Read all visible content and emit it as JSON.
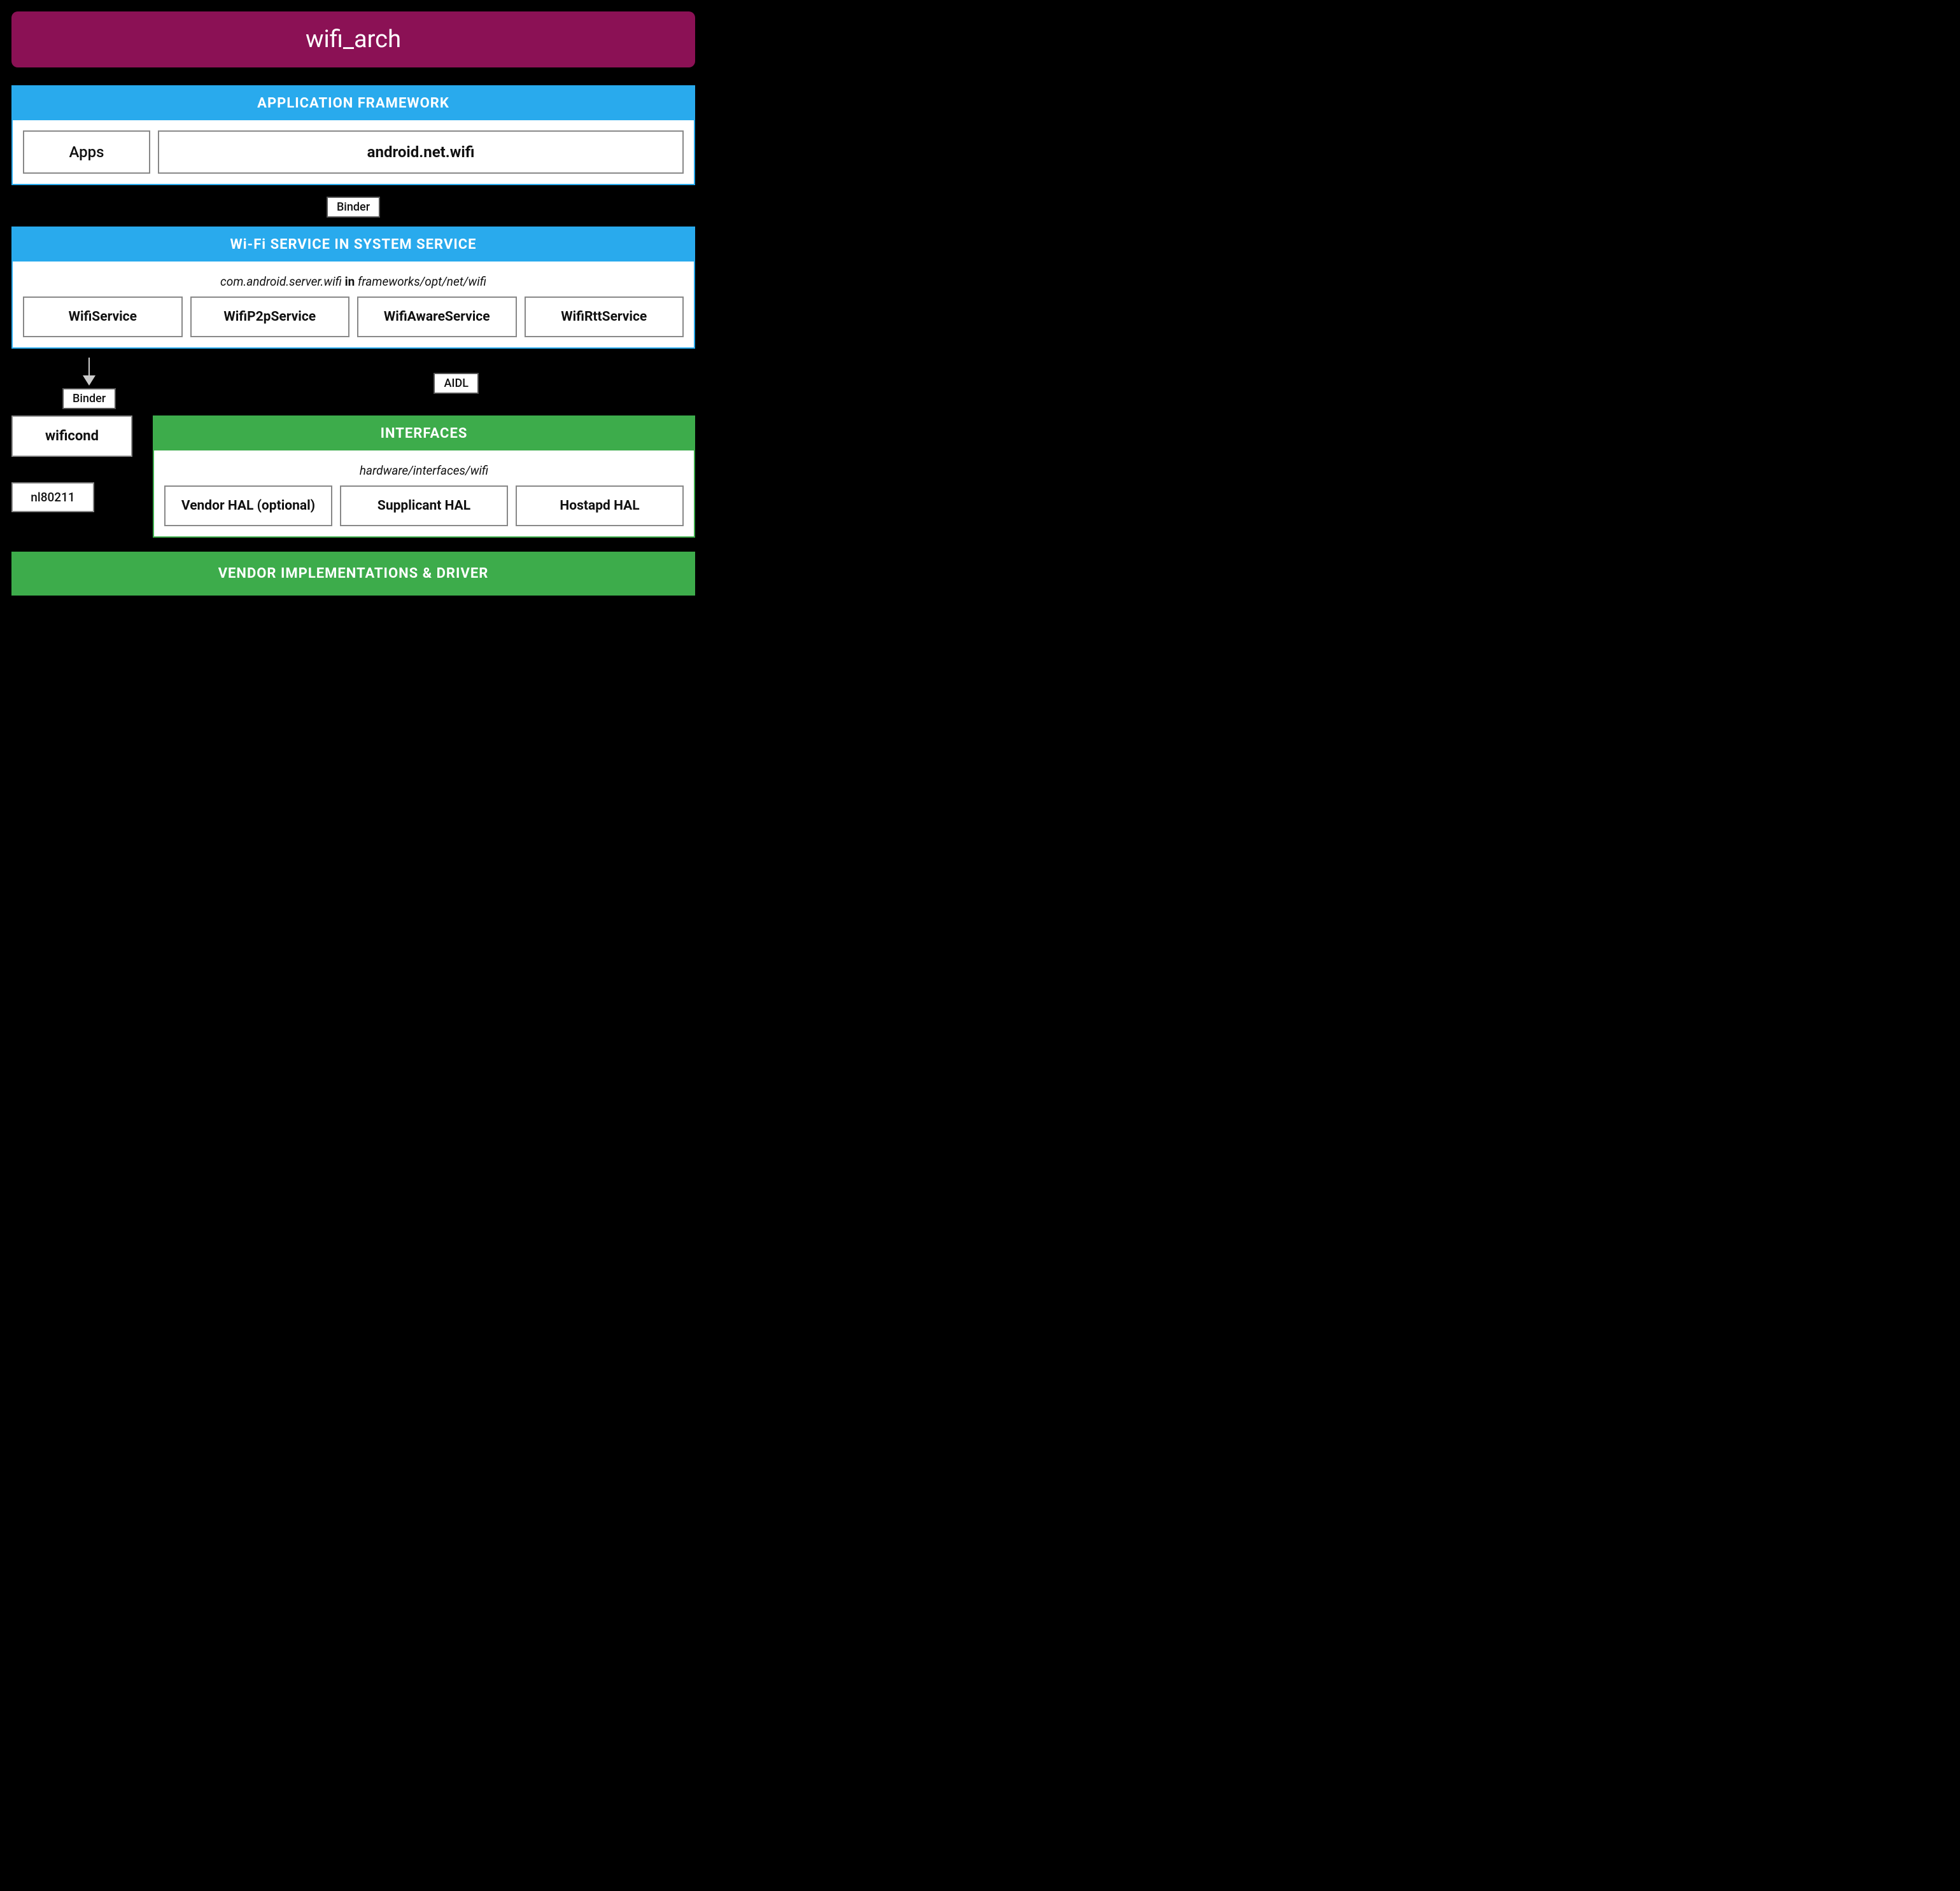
{
  "title": "wifi_arch",
  "app_framework": {
    "header": "APPLICATION FRAMEWORK",
    "apps_label": "Apps",
    "android_net_wifi_label": "android.net.wifi"
  },
  "binder_label": "Binder",
  "wifi_service": {
    "header": "Wi-Fi SERVICE IN SYSTEM SERVICE",
    "note_italic": "com.android.server.wifi",
    "note_in": "in",
    "note_path": "frameworks/opt/net/wifi",
    "services": [
      "WifiService",
      "WifiP2pService",
      "WifiAwareService",
      "WifiRttService"
    ]
  },
  "binder2_label": "Binder",
  "aidl_label": "AIDL",
  "wificond_label": "wificond",
  "nl80211_label": "nl80211",
  "interfaces": {
    "header": "INTERFACES",
    "path": "hardware/interfaces/wifi",
    "hals": [
      "Vendor HAL (optional)",
      "Supplicant HAL",
      "Hostapd HAL"
    ]
  },
  "vendor_bar": "VENDOR IMPLEMENTATIONS & DRIVER"
}
